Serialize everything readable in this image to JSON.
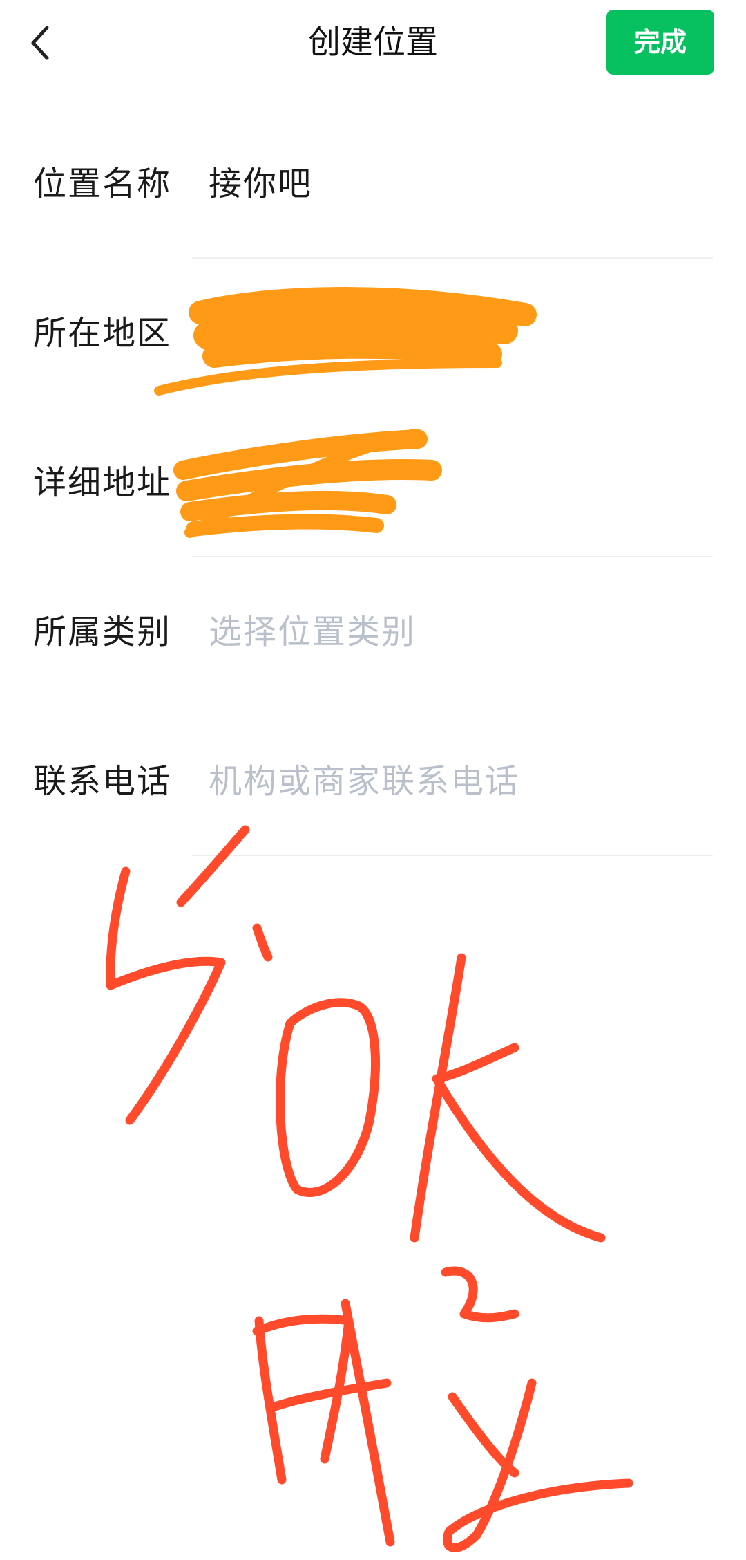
{
  "header": {
    "title": "创建位置",
    "done_label": "完成",
    "back_icon": "chevron-left-icon"
  },
  "form": {
    "location_name": {
      "label": "位置名称",
      "value": "接你吧"
    },
    "region": {
      "label": "所在地区",
      "value": ""
    },
    "address": {
      "label": "详细地址",
      "value": ""
    },
    "category": {
      "label": "所属类别",
      "placeholder": "选择位置类别"
    },
    "phone": {
      "label": "联系电话",
      "placeholder": "机构或商家联系电话"
    }
  },
  "colors": {
    "accent": "#07c160",
    "placeholder": "#b9c0cb",
    "redaction": "#ff9a16",
    "handwriting": "#ff4b2b"
  }
}
